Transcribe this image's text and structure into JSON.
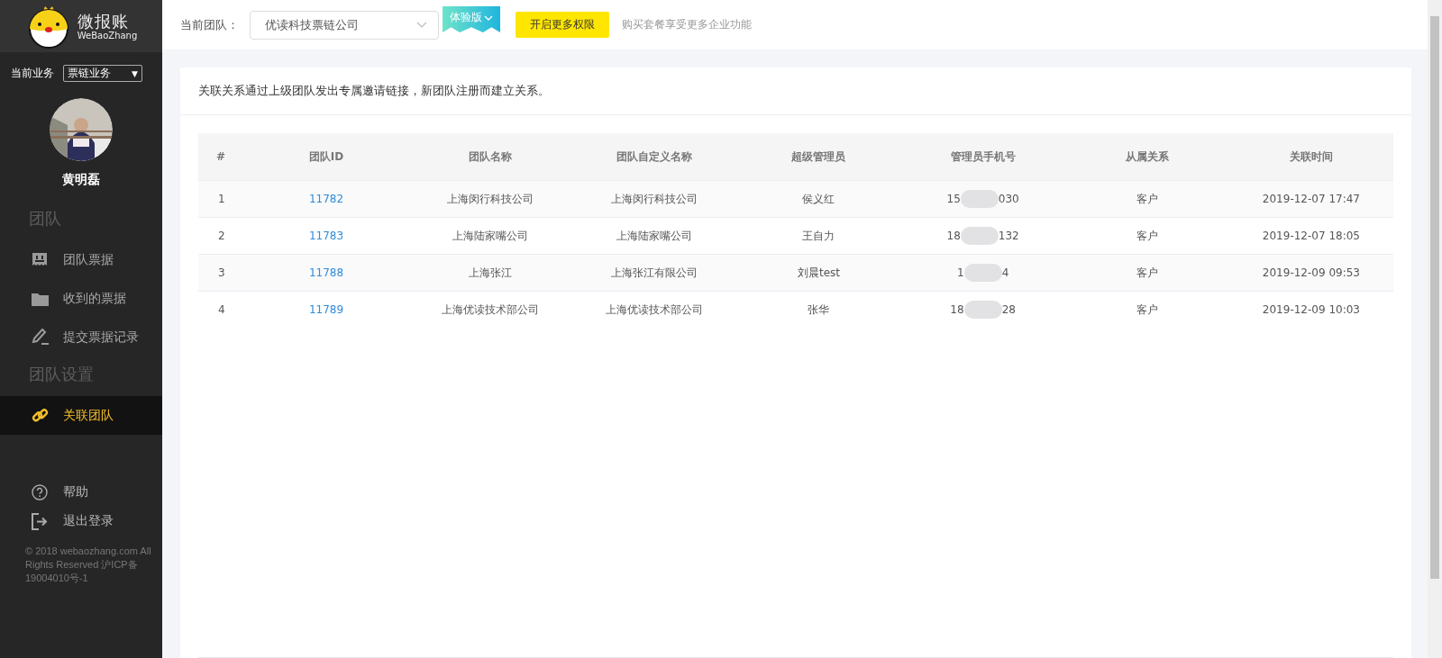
{
  "brand": {
    "name": "微报账",
    "subtitle": "WeBaoZhang"
  },
  "business": {
    "label": "当前业务",
    "value": "票链业务",
    "caret": "▼"
  },
  "user": {
    "name": "黄明磊"
  },
  "sidebar": {
    "items": [
      {
        "kind": "heading",
        "label": "团队"
      },
      {
        "kind": "link",
        "label": "团队票据",
        "selected": false
      },
      {
        "kind": "link",
        "label": "收到的票据",
        "selected": false
      },
      {
        "kind": "link",
        "label": "提交票据记录",
        "selected": false
      },
      {
        "kind": "heading",
        "label": "团队设置"
      },
      {
        "kind": "link",
        "label": "关联团队",
        "selected": true
      }
    ],
    "bottom": [
      {
        "label": "帮助"
      },
      {
        "label": "退出登录"
      }
    ],
    "footer": "© 2018 webaozhang.com All Rights Reserved 沪ICP备19004010号-1"
  },
  "topbar": {
    "team_label": "当前团队：",
    "team_value": "优读科技票链公司",
    "edition": "体验版",
    "upgrade_button": "开启更多权限",
    "promo": "购买套餐享受更多企业功能"
  },
  "notice": "关联关系通过上级团队发出专属邀请链接，新团队注册而建立关系。",
  "table": {
    "columns": [
      "#",
      "团队ID",
      "团队名称",
      "团队自定义名称",
      "超级管理员",
      "管理员手机号",
      "从属关系",
      "关联时间"
    ],
    "rows": [
      {
        "index": "1",
        "team_id": "11782",
        "name": "上海闵行科技公司",
        "custom_name": "上海闵行科技公司",
        "admin": "侯义红",
        "phone_start": "15",
        "phone_end": "030",
        "relation": "客户",
        "time": "2019-12-07 17:47"
      },
      {
        "index": "2",
        "team_id": "11783",
        "name": "上海陆家嘴公司",
        "custom_name": "上海陆家嘴公司",
        "admin": "王自力",
        "phone_start": "18",
        "phone_end": "132",
        "relation": "客户",
        "time": "2019-12-07 18:05"
      },
      {
        "index": "3",
        "team_id": "11788",
        "name": "上海张江",
        "custom_name": "上海张江有限公司",
        "admin": "刘晨test",
        "phone_start": "1",
        "phone_end": "4",
        "relation": "客户",
        "time": "2019-12-09 09:53"
      },
      {
        "index": "4",
        "team_id": "11789",
        "name": "上海优读技术部公司",
        "custom_name": "上海优读技术部公司",
        "admin": "张华",
        "phone_start": "18",
        "phone_end": "28",
        "relation": "客户",
        "time": "2019-12-09 10:03"
      }
    ]
  }
}
